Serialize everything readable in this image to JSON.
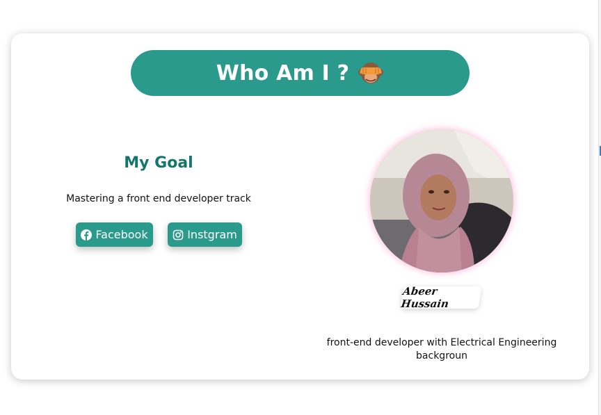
{
  "header": {
    "title": "Who Am I ?",
    "emoji_icon": "see-no-evil-monkey-icon"
  },
  "goal": {
    "heading": "My Goal",
    "text": "Mastering a front end developer track"
  },
  "social": {
    "facebook_label": "Facebook",
    "instagram_label": "Instgram",
    "facebook_icon": "facebook-icon",
    "instagram_icon": "instagram-icon"
  },
  "profile": {
    "name": "Abeer Hussain",
    "bio": "front-end developer with Electrical Engineering backgroun"
  },
  "colors": {
    "accent": "#2a9a8c",
    "heading": "#14756a",
    "avatar_glow": "#ffaad2"
  }
}
